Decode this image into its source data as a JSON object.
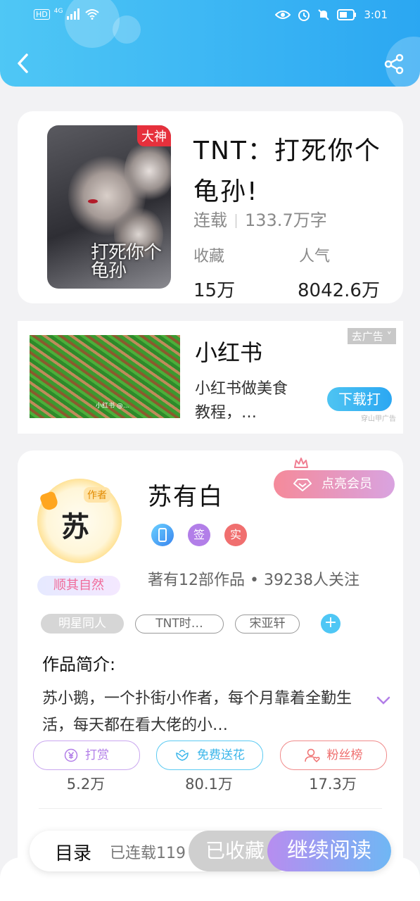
{
  "status_bar": {
    "network_hd": "HD",
    "network_gen": "4G",
    "time": "3:01"
  },
  "icons": {
    "back": "back-chevron-icon",
    "share": "share-icon",
    "signal": "signal-icon",
    "wifi": "wifi-icon",
    "eye": "eye-icon",
    "alarm": "alarm-icon",
    "mute": "bell-off-icon",
    "battery": "battery-icon"
  },
  "book": {
    "badge": "大神",
    "cover_text": "打死你个龟孙",
    "title": "TNT：打死你个龟孙!",
    "status": "连载",
    "words": "133.7万字",
    "favorites_label": "收藏",
    "favorites_value": "15万",
    "popularity_label": "人气",
    "popularity_value": "8042.6万"
  },
  "ad": {
    "title": "小红书",
    "description": "小红书做美食教程，…",
    "close_label": "去广告",
    "button_label": "下载打",
    "source": "穿山甲广告",
    "image_watermark": "小红书 @..."
  },
  "author": {
    "avatar_char": "苏",
    "avatar_tag": "作者",
    "nickname_badge": "顺其自然",
    "name": "苏有白",
    "vip_label": "点亮会员",
    "badges": [
      "",
      "签",
      "实"
    ],
    "info": "著有12部作品 • 39238人关注",
    "tags": [
      "明星同人",
      "TNT时…",
      "宋亚轩"
    ],
    "add_tag": "+",
    "intro_heading": "作品简介:",
    "intro_text": "苏小鹅，一个扑街小作者，每个月靠着全勤生活，每天都在看大佬的小…",
    "actions": [
      {
        "label": "打赏",
        "value": "5.2万"
      },
      {
        "label": "免费送花",
        "value": "80.1万"
      },
      {
        "label": "粉丝榜",
        "value": "17.3万"
      }
    ]
  },
  "bottom_bar": {
    "catalog": "目录",
    "progress": "已连载119",
    "collected": "已收藏",
    "continue": "继续阅读"
  },
  "colors": {
    "header_start": "#4fc7f5",
    "header_end": "#2ba7f2",
    "vip_gradient_start": "#f58a9a",
    "vip_gradient_end": "#d9a3e0",
    "read_gradient_start": "#b78df0",
    "read_gradient_end": "#6fb7f4"
  }
}
